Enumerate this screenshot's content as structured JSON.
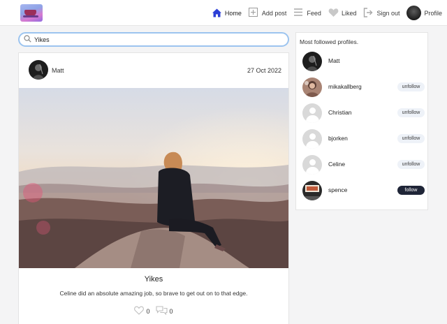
{
  "nav": {
    "items": [
      {
        "label": "Home",
        "icon": "home-icon"
      },
      {
        "label": "Add post",
        "icon": "add-post-icon"
      },
      {
        "label": "Feed",
        "icon": "feed-icon"
      },
      {
        "label": "Liked",
        "icon": "heart-icon"
      },
      {
        "label": "Sign out",
        "icon": "sign-out-icon"
      },
      {
        "label": "Profile",
        "icon": "profile-avatar"
      }
    ],
    "active_color": "#2c3fd6"
  },
  "search": {
    "value": "Yikes"
  },
  "post": {
    "author": "Matt",
    "date": "27 Oct 2022",
    "title": "Yikes",
    "body": "Celine did an absolute amazing job, so brave to get out on to that edge.",
    "likes": "0",
    "comments": "0"
  },
  "sidebar": {
    "title": "Most followed profiles.",
    "profiles": [
      {
        "name": "Matt",
        "button": ""
      },
      {
        "name": "mikakallberg",
        "button": "unfollow"
      },
      {
        "name": "Christian",
        "button": "unfollow"
      },
      {
        "name": "bjorken",
        "button": "unfollow"
      },
      {
        "name": "Celine",
        "button": "unfollow"
      },
      {
        "name": "spence",
        "button": "follow"
      }
    ]
  }
}
